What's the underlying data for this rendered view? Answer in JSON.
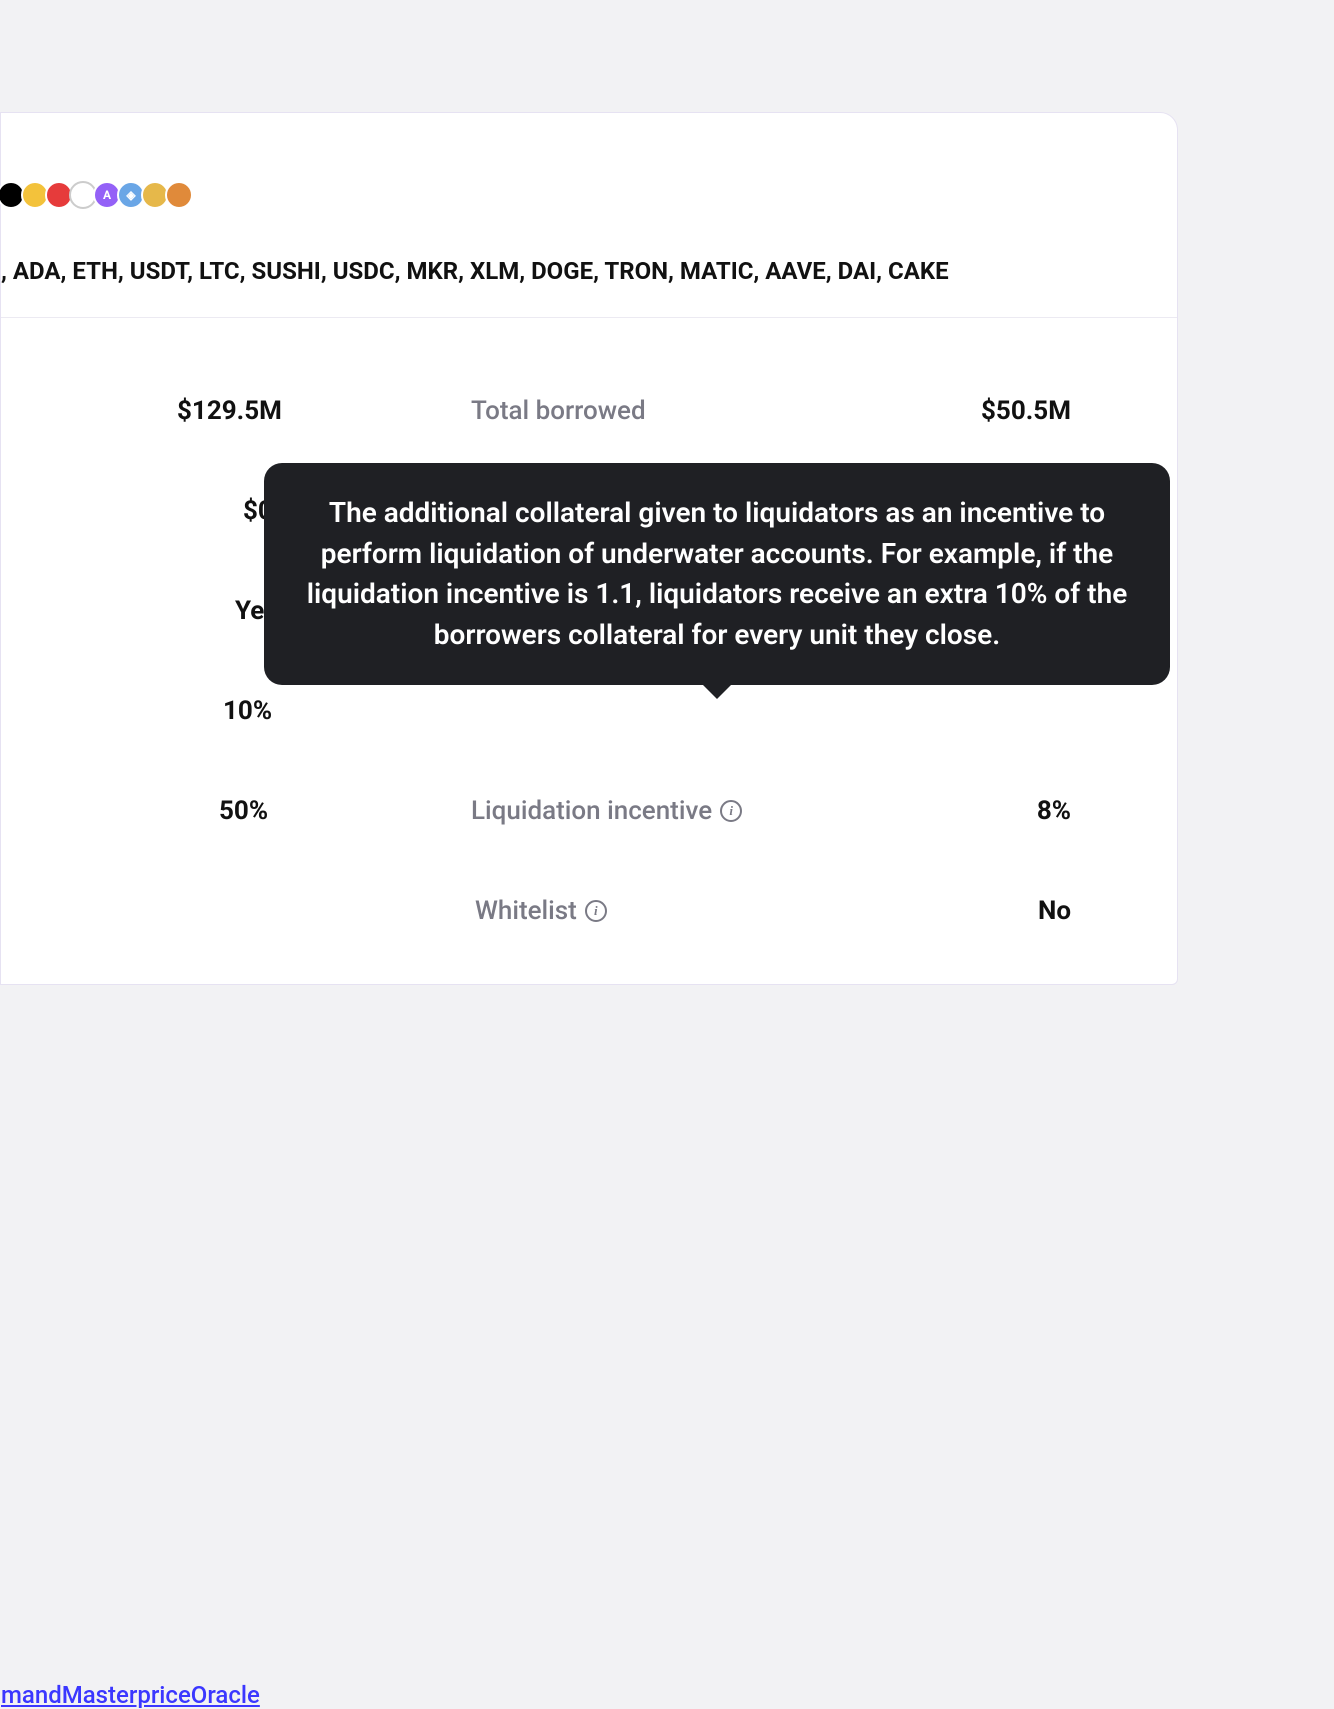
{
  "tokens": {
    "icon_colors": [
      "#000000",
      "#f3c23b",
      "#e63b3b",
      "#ffffff",
      "#9461f7",
      "#6aa6e6",
      "#e6b84a",
      "#e08a3a"
    ],
    "assets_text": ", ADA, ETH, USDT, LTC, SUSHI, USDC, MKR, XLM, DOGE, TRON, MATIC, AAVE, DAI, CAKE"
  },
  "stats": {
    "row1": {
      "value_left": "$129.5M",
      "label": "Total borrowed",
      "value_right": "$50.5M"
    },
    "row2": {
      "value_left": "$0"
    },
    "row3": {
      "value_left": "Yes"
    },
    "row4": {
      "value_left": "10%"
    },
    "row5": {
      "value_left": "50%",
      "label": "Liquidation incentive",
      "value_right": "8%"
    },
    "row6": {
      "oracle_link": "mandMasterpriceOracle",
      "label": "Whitelist",
      "value_right": "No"
    }
  },
  "tooltip": {
    "text": "The additional collateral given to liquidators as an incentive to perform liquidation of underwater accounts. For example, if the liquidation incentive is 1.1, liquidators receive an extra 10% of the borrowers collateral for every unit they close."
  }
}
